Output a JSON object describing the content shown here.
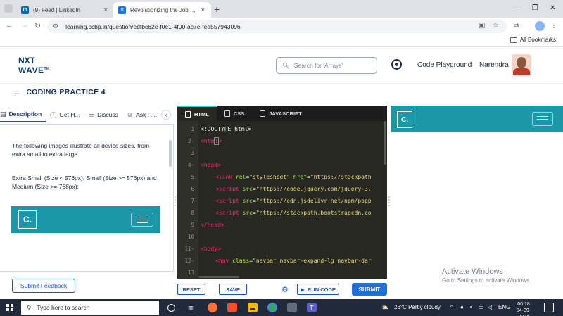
{
  "browser": {
    "tabs": [
      {
        "title": "(9) Feed | LinkedIn",
        "favicon": "linkedin-icon",
        "color": "#0a66c2",
        "active": false
      },
      {
        "title": "Revolutionizing the Job Market",
        "favicon": "ccbp-icon",
        "color": "#1a73e8",
        "active": true
      }
    ],
    "url": "learning.ccbp.in/question/edfbc62e-f0e1-4f00-ac7e-fea557943096",
    "all_bookmarks": "All Bookmarks"
  },
  "header": {
    "logo_line1": "NXT",
    "logo_line2": "WAVE",
    "logo_tm": "TM",
    "search_placeholder": "Search for 'Arrays'",
    "code_playground": "Code Playground",
    "user_name": "Narendra"
  },
  "practice": {
    "title": "CODING PRACTICE 4"
  },
  "left_panel": {
    "tabs": [
      {
        "label": "Description",
        "icon": "document-icon"
      },
      {
        "label": "Get H...",
        "icon": "help-icon"
      },
      {
        "label": "Discuss",
        "icon": "chat-icon"
      },
      {
        "label": "Ask F...",
        "icon": "people-icon"
      }
    ],
    "para1": "The following images illustrate all device sizes, from extra small to extra large.",
    "para2": "Extra Small (Size < 576px), Small (Size >= 576px) and Medium (Size >= 768px):",
    "preview_logo": "C.",
    "feedback_button": "Submit Feedback"
  },
  "editor": {
    "tabs": [
      {
        "label": "HTML",
        "active": true
      },
      {
        "label": "CSS",
        "active": false
      },
      {
        "label": "JAVASCRIPT",
        "active": false
      }
    ],
    "lines": [
      {
        "n": "1",
        "fold": false
      },
      {
        "n": "2",
        "fold": true
      },
      {
        "n": "3",
        "fold": false
      },
      {
        "n": "4",
        "fold": true
      },
      {
        "n": "5",
        "fold": false
      },
      {
        "n": "6",
        "fold": false
      },
      {
        "n": "7",
        "fold": false
      },
      {
        "n": "8",
        "fold": false
      },
      {
        "n": "9",
        "fold": false
      },
      {
        "n": "10",
        "fold": false
      },
      {
        "n": "11",
        "fold": true
      },
      {
        "n": "12",
        "fold": true
      },
      {
        "n": "13",
        "fold": false
      }
    ],
    "code": {
      "l1": "<!DOCTYPE html>",
      "l2_open": "<",
      "l2_tag_a": "htm",
      "l2_tag_b": "l",
      "l2_close": ">",
      "l4_open": "<",
      "l4_tag": "head",
      "l4_close": ">",
      "l5_lt": "<",
      "l5_tag": "link",
      "l5_attr1": " rel",
      "l5_eq1": "=",
      "l5_val1": "\"stylesheet\"",
      "l5_attr2": " href",
      "l5_eq2": "=",
      "l5_val2": "\"https://stackpath",
      "l6_lt": "<",
      "l6_tag": "script",
      "l6_attr": " src",
      "l6_eq": "=",
      "l6_val": "\"https://code.jquery.com/jquery-3.",
      "l7_lt": "<",
      "l7_tag": "script",
      "l7_attr": " src",
      "l7_eq": "=",
      "l7_val": "\"https://cdn.jsdelivr.net/npm/popp",
      "l8_lt": "<",
      "l8_tag": "script",
      "l8_attr": " src",
      "l8_eq": "=",
      "l8_val": "\"https://stackpath.bootstrapcdn.co",
      "l9_lt": "</",
      "l9_tag": "head",
      "l9_gt": ">",
      "l11_lt": "<",
      "l11_tag": "body",
      "l11_gt": ">",
      "l12_lt": "<",
      "l12_tag": "nav",
      "l12_attr": " class",
      "l12_eq": "=",
      "l12_val": "\"navbar navbar-expand-lg navbar-dar"
    },
    "buttons": {
      "reset": "RESET",
      "save": "SAVE",
      "run": "RUN CODE",
      "submit": "SUBMIT"
    }
  },
  "output": {
    "logo": "C.",
    "watermark_title": "Activate Windows",
    "watermark_sub": "Go to Settings to activate Windows."
  },
  "taskbar": {
    "search_placeholder": "Type here to search",
    "weather": "26°C  Partly cloudy",
    "language": "ENG",
    "time": "00:18",
    "date": "04-09-2024"
  },
  "colors": {
    "brand_teal": "#1a98a9",
    "primary_blue": "#1d4ed8",
    "editor_bg": "#272822",
    "navy": "#0f2d5c"
  }
}
